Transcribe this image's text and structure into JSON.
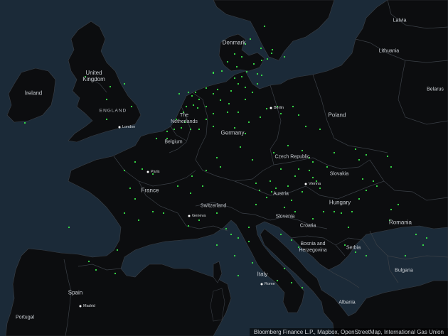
{
  "colors": {
    "water": "#1b2a38",
    "land": "#0c0d0f",
    "border": "#3b4047",
    "site": "#39e64a",
    "city": "#ffffff"
  },
  "countries": [
    {
      "id": "latvia",
      "label": "Latvia"
    },
    {
      "id": "lithuania",
      "label": "Lithuania"
    },
    {
      "id": "belarus",
      "label": "Belarus"
    },
    {
      "id": "denmark",
      "label": "Denmark"
    },
    {
      "id": "ireland",
      "label": "Ireland"
    },
    {
      "id": "uk",
      "label": "United\nKingdom"
    },
    {
      "id": "england",
      "label": "ENGLAND"
    },
    {
      "id": "netherlands",
      "label": "The\nNetherlands"
    },
    {
      "id": "belgium",
      "label": "Belgium"
    },
    {
      "id": "germany",
      "label": "Germany"
    },
    {
      "id": "poland",
      "label": "Poland"
    },
    {
      "id": "czech",
      "label": "Czech Republic"
    },
    {
      "id": "slovakia",
      "label": "Slovakia"
    },
    {
      "id": "austria",
      "label": "Austria"
    },
    {
      "id": "hungary",
      "label": "Hungary"
    },
    {
      "id": "romania",
      "label": "Romania"
    },
    {
      "id": "france",
      "label": "France"
    },
    {
      "id": "switzerland",
      "label": "Switzerland"
    },
    {
      "id": "slovenia",
      "label": "Slovenia"
    },
    {
      "id": "croatia",
      "label": "Croatia"
    },
    {
      "id": "bosnia",
      "label": "Bosnia and\nHerzegovina"
    },
    {
      "id": "serbia",
      "label": "Serbia"
    },
    {
      "id": "bulgaria",
      "label": "Bulgaria"
    },
    {
      "id": "italy",
      "label": "Italy"
    },
    {
      "id": "spain",
      "label": "Spain"
    },
    {
      "id": "portugal",
      "label": "Portugal"
    },
    {
      "id": "albania",
      "label": "Albania"
    }
  ],
  "cities": [
    {
      "id": "london",
      "label": "London"
    },
    {
      "id": "berlin",
      "label": "Berlin"
    },
    {
      "id": "paris",
      "label": "Paris"
    },
    {
      "id": "vienna",
      "label": "Vienna"
    },
    {
      "id": "geneva",
      "label": "Geneva"
    },
    {
      "id": "rome",
      "label": "Rome"
    },
    {
      "id": "madrid",
      "label": "Madrid"
    }
  ],
  "attribution": "Bloomberg Finance L.P., Mapbox, OpenStreetMap, International Gas Union"
}
